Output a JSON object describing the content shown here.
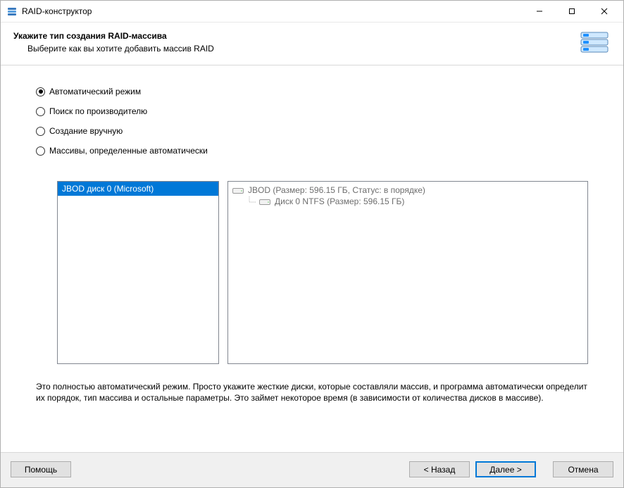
{
  "window": {
    "title": "RAID-конструктор"
  },
  "header": {
    "title": "Укажите тип создания RAID-массива",
    "subtitle": "Выберите как вы хотите добавить массив RAID"
  },
  "options": {
    "auto": {
      "label": "Автоматический режим",
      "selected": true
    },
    "vendor": {
      "label": "Поиск по производителю",
      "selected": false
    },
    "manual": {
      "label": "Создание вручную",
      "selected": false
    },
    "detected": {
      "label": "Массивы, определенные автоматически",
      "selected": false
    }
  },
  "left_panel": {
    "items": [
      {
        "label": "JBOD диск 0 (Microsoft)",
        "selected": true
      }
    ]
  },
  "right_panel": {
    "root": {
      "label": "JBOD (Размер: 596.15 ГБ, Статус: в порядке)"
    },
    "child": {
      "label": "Диск 0 NTFS (Размер: 596.15 ГБ)"
    }
  },
  "description": "Это полностью автоматический режим. Просто укажите жесткие диски, которые составляли массив, и программа автоматически определит их порядок, тип массива и остальные параметры. Это займет некоторое время (в зависимости от количества дисков в массиве).",
  "buttons": {
    "help": "Помощь",
    "back": "< Назад",
    "next": "Далее >",
    "cancel": "Отмена"
  },
  "icons": {
    "app": "raid-app-icon",
    "header": "disk-stack-icon",
    "disk": "hdd-icon"
  }
}
